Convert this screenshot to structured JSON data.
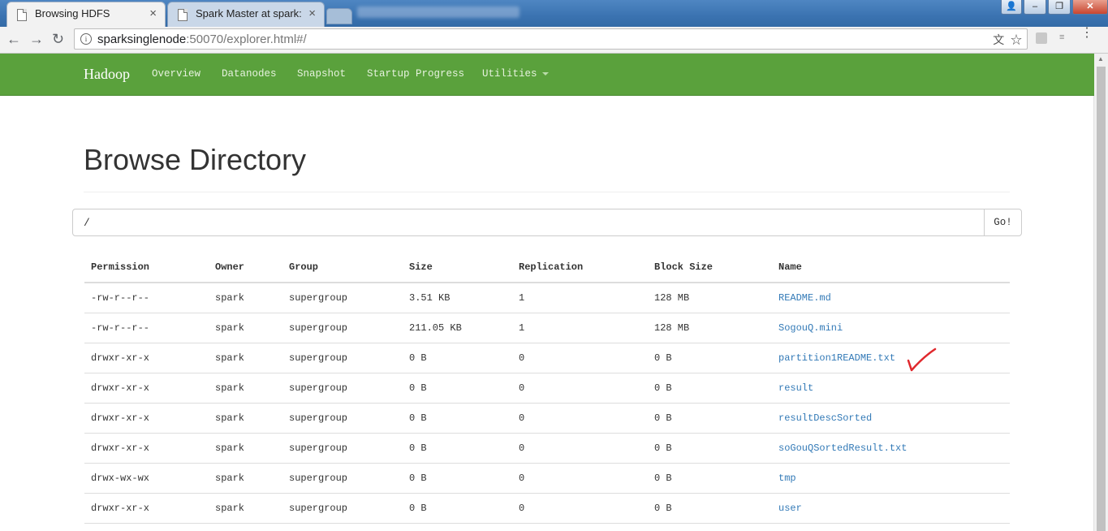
{
  "browser": {
    "tabs": [
      {
        "title": "Browsing HDFS",
        "close": "×"
      },
      {
        "title": "Spark Master at spark:/",
        "close": "×"
      }
    ],
    "url_host": "sparksinglenode",
    "url_rest": ":50070/explorer.html#/"
  },
  "navbar": {
    "brand": "Hadoop",
    "links": [
      "Overview",
      "Datanodes",
      "Snapshot",
      "Startup Progress",
      "Utilities"
    ]
  },
  "page": {
    "title": "Browse Directory",
    "path_value": "/",
    "go_label": "Go!"
  },
  "table": {
    "headers": [
      "Permission",
      "Owner",
      "Group",
      "Size",
      "Replication",
      "Block Size",
      "Name"
    ],
    "rows": [
      [
        "-rw-r--r--",
        "spark",
        "supergroup",
        "3.51 KB",
        "1",
        "128 MB",
        "README.md"
      ],
      [
        "-rw-r--r--",
        "spark",
        "supergroup",
        "211.05 KB",
        "1",
        "128 MB",
        "SogouQ.mini"
      ],
      [
        "drwxr-xr-x",
        "spark",
        "supergroup",
        "0 B",
        "0",
        "0 B",
        "partition1README.txt"
      ],
      [
        "drwxr-xr-x",
        "spark",
        "supergroup",
        "0 B",
        "0",
        "0 B",
        "result"
      ],
      [
        "drwxr-xr-x",
        "spark",
        "supergroup",
        "0 B",
        "0",
        "0 B",
        "resultDescSorted"
      ],
      [
        "drwxr-xr-x",
        "spark",
        "supergroup",
        "0 B",
        "0",
        "0 B",
        "soGouQSortedResult.txt"
      ],
      [
        "drwx-wx-wx",
        "spark",
        "supergroup",
        "0 B",
        "0",
        "0 B",
        "tmp"
      ],
      [
        "drwxr-xr-x",
        "spark",
        "supergroup",
        "0 B",
        "0",
        "0 B",
        "user"
      ]
    ]
  },
  "colors": {
    "navbar": "#5aa13c",
    "link": "#337ab7",
    "annotation": "#e0282d"
  }
}
